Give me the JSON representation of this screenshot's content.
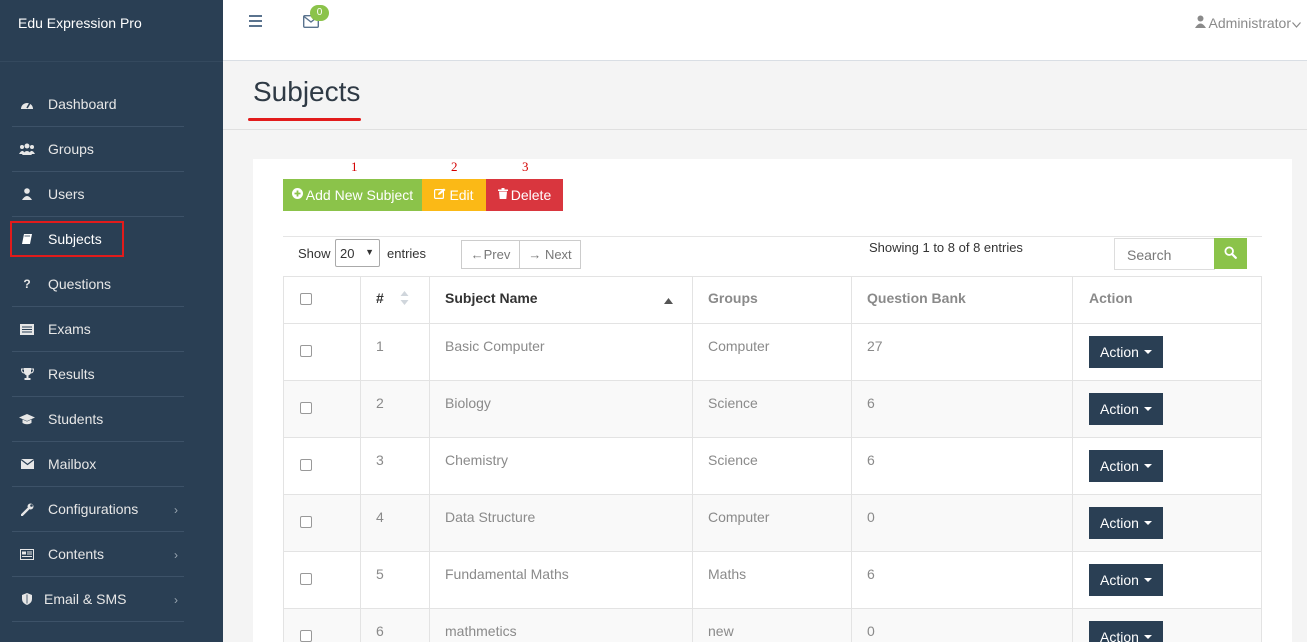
{
  "app": {
    "title": "Edu Expression Pro"
  },
  "sidebar": {
    "items": [
      {
        "label": "Dashboard",
        "icon": "dashboard-icon"
      },
      {
        "label": "Groups",
        "icon": "users-group-icon"
      },
      {
        "label": "Users",
        "icon": "user-icon"
      },
      {
        "label": "Subjects",
        "icon": "book-icon",
        "active": true
      },
      {
        "label": "Questions",
        "icon": "question-icon"
      },
      {
        "label": "Exams",
        "icon": "list-icon"
      },
      {
        "label": "Results",
        "icon": "trophy-icon"
      },
      {
        "label": "Students",
        "icon": "graduation-cap-icon"
      },
      {
        "label": "Mailbox",
        "icon": "envelope-icon"
      },
      {
        "label": "Configurations",
        "icon": "wrench-icon",
        "has_submenu": true
      },
      {
        "label": "Contents",
        "icon": "contents-icon",
        "has_submenu": true
      },
      {
        "label": "Email & SMS",
        "icon": "shield-icon",
        "has_submenu": true
      }
    ]
  },
  "topnav": {
    "mail_count": "0",
    "user": "Administrator"
  },
  "page": {
    "title": "Subjects"
  },
  "steps": [
    "1",
    "2",
    "3"
  ],
  "toolbar": {
    "add_label": "Add New Subject",
    "edit_label": "Edit",
    "delete_label": "Delete"
  },
  "datatable": {
    "show_label": "Show",
    "page_size": "20",
    "entries_label": "entries",
    "prev_label": "←Prev",
    "next_label": "→ Next",
    "info": "Showing 1 to 8 of 8 entries",
    "search_placeholder": "Search"
  },
  "table": {
    "columns": [
      "#",
      "Subject Name",
      "Groups",
      "Question Bank",
      "Action"
    ],
    "action_label": "Action",
    "rows": [
      {
        "num": "1",
        "name": "Basic Computer",
        "group": "Computer",
        "bank": "27"
      },
      {
        "num": "2",
        "name": "Biology",
        "group": "Science",
        "bank": "6"
      },
      {
        "num": "3",
        "name": "Chemistry",
        "group": "Science",
        "bank": "6"
      },
      {
        "num": "4",
        "name": "Data Structure",
        "group": "Computer",
        "bank": "0"
      },
      {
        "num": "5",
        "name": "Fundamental Maths",
        "group": "Maths",
        "bank": "6"
      },
      {
        "num": "6",
        "name": "mathmetics",
        "group": "new",
        "bank": "0"
      }
    ]
  },
  "colors": {
    "sidebar_bg": "#2a3f54",
    "add_green": "#8bc34a",
    "edit_yellow": "#fbb916",
    "delete_red": "#d9363e",
    "highlight_red": "#e21b1b"
  }
}
